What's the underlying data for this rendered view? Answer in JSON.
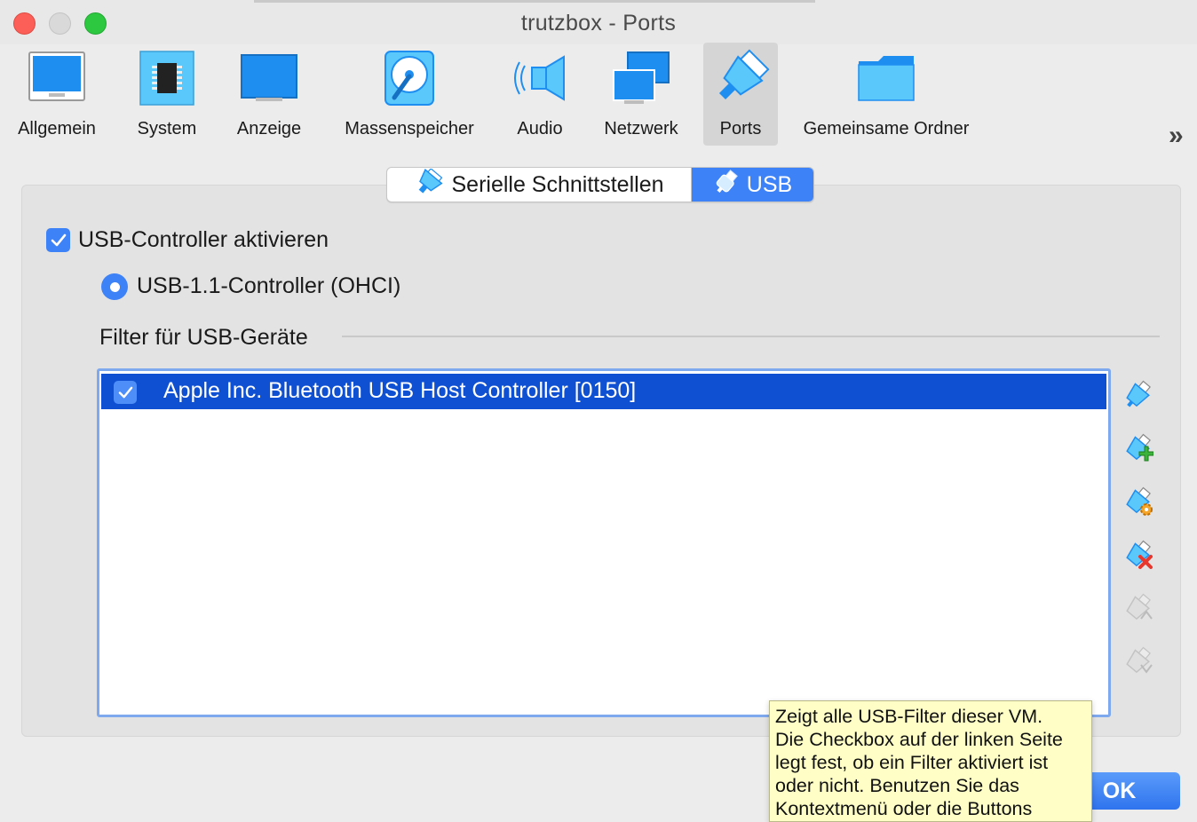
{
  "window": {
    "title": "trutzbox - Ports"
  },
  "toolbar": {
    "items": [
      {
        "label": "Allgemein",
        "icon": "general-monitor-icon"
      },
      {
        "label": "System",
        "icon": "chip-icon"
      },
      {
        "label": "Anzeige",
        "icon": "display-icon"
      },
      {
        "label": "Massenspeicher",
        "icon": "storage-disk-icon"
      },
      {
        "label": "Audio",
        "icon": "speaker-icon"
      },
      {
        "label": "Netzwerk",
        "icon": "network-icon"
      },
      {
        "label": "Ports",
        "icon": "ports-plug-icon",
        "selected": true
      },
      {
        "label": "Gemeinsame Ordner",
        "icon": "folder-icon"
      }
    ],
    "more_icon": "chevron-double-right-icon"
  },
  "tabs": {
    "serial_label": "Serielle Schnittstellen",
    "usb_label": "USB",
    "active": "USB"
  },
  "usb": {
    "enable_label": "USB-Controller aktivieren",
    "enable_checked": true,
    "controller_label": "USB-1.1-Controller (OHCI)",
    "controller_selected": true,
    "filters_heading": "Filter für USB-Geräte",
    "filters": [
      {
        "label": "Apple Inc. Bluetooth USB Host Controller [0150]",
        "checked": true,
        "selected": true
      }
    ],
    "side_buttons": [
      {
        "icon": "usb-filter-new-icon",
        "enabled": true
      },
      {
        "icon": "usb-filter-add-icon",
        "enabled": true
      },
      {
        "icon": "usb-filter-edit-icon",
        "enabled": true
      },
      {
        "icon": "usb-filter-remove-icon",
        "enabled": true
      },
      {
        "icon": "usb-filter-move-up-icon",
        "enabled": false
      },
      {
        "icon": "usb-filter-move-down-icon",
        "enabled": false
      }
    ]
  },
  "tooltip": {
    "lines": [
      "Zeigt alle USB-Filter dieser VM.",
      "Die Checkbox auf der linken Seite",
      "legt fest, ob ein Filter aktiviert ist",
      "oder nicht. Benutzen Sie das",
      "Kontextmenü oder die Buttons"
    ]
  },
  "footer": {
    "ok_label": "OK"
  },
  "colors": {
    "accent": "#3e82f7",
    "selection": "#0f50d2",
    "tooltip_bg": "#fefec6"
  }
}
